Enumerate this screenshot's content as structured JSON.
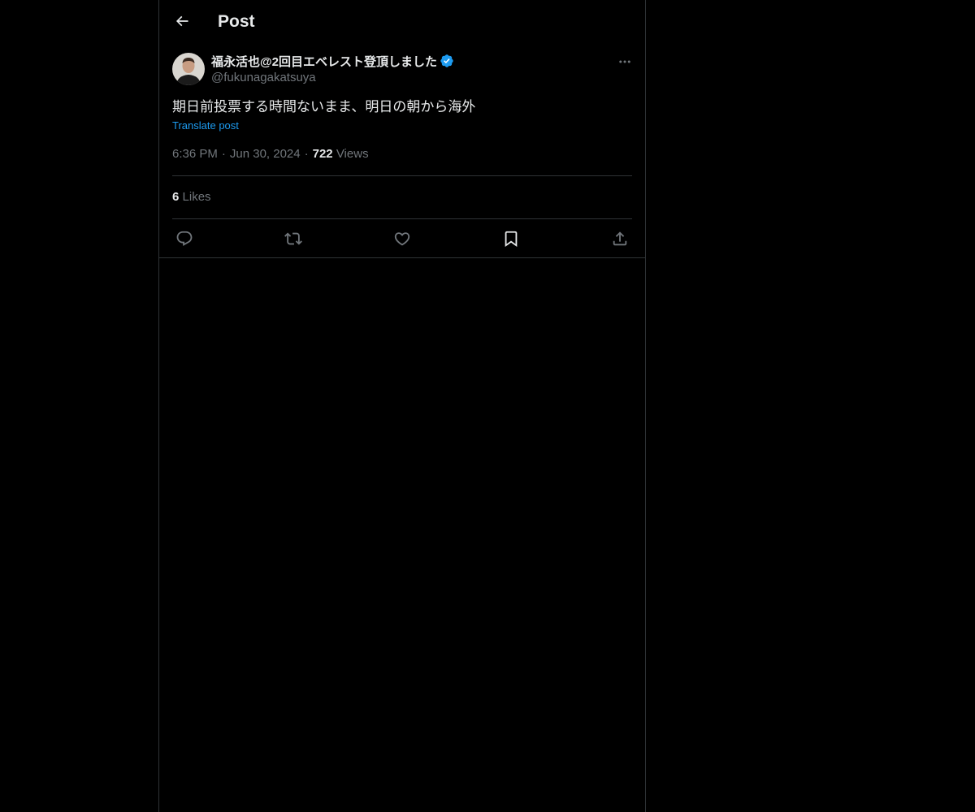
{
  "header": {
    "title": "Post",
    "back_icon": "arrow-left-icon"
  },
  "post": {
    "author": {
      "display_name": "福永活也@2回目エベレスト登頂しました",
      "handle": "@fukunagakatsuya",
      "verified": true
    },
    "text": "期日前投票する時間ないまま、明日の朝から海外",
    "translate_label": "Translate post",
    "time": "6:36 PM",
    "separator": "·",
    "date": "Jun 30, 2024",
    "views_count": "722",
    "views_label": "Views",
    "likes_count": "6",
    "likes_label": "Likes"
  },
  "actions": [
    {
      "name": "reply",
      "icon": "reply-icon"
    },
    {
      "name": "repost",
      "icon": "repost-icon"
    },
    {
      "name": "like",
      "icon": "heart-icon"
    },
    {
      "name": "bookmark",
      "icon": "bookmark-icon"
    },
    {
      "name": "share",
      "icon": "share-icon"
    }
  ],
  "colors": {
    "background": "#000000",
    "text_primary": "#e7e9ea",
    "text_secondary": "#71767b",
    "accent": "#1d9bf0",
    "border": "#2f3336"
  }
}
